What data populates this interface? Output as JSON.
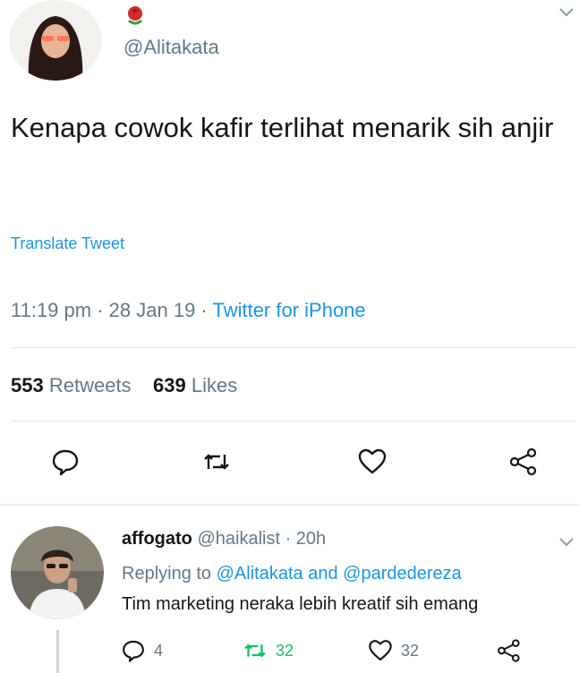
{
  "tweet": {
    "name_emoji": "rose-icon",
    "handle": "@Alitakata",
    "text": "Kenapa cowok kafir terlihat menarik sih anjir",
    "translate_label": "Translate Tweet",
    "time": "11:19 pm",
    "date": "28 Jan 19",
    "separator": " · ",
    "client": "Twitter for iPhone",
    "retweets_count": "553",
    "retweets_label": "Retweets",
    "likes_count": "639",
    "likes_label": "Likes"
  },
  "reply": {
    "name": "affogato",
    "handle": "@haikalist",
    "time": "20h",
    "separator": " · ",
    "replying_prefix": "Replying to",
    "replying_to_1": "@Alitakata",
    "replying_and": "and",
    "replying_to_2": "@pardedereza",
    "text": "Tim marketing neraka lebih kreatif sih emang",
    "reply_count": "4",
    "retweet_count": "32",
    "like_count": "32"
  },
  "colors": {
    "link": "#1b95e0",
    "secondary_text": "#657786",
    "retweet_green": "#17bf63",
    "divider": "#e1e8ed"
  }
}
